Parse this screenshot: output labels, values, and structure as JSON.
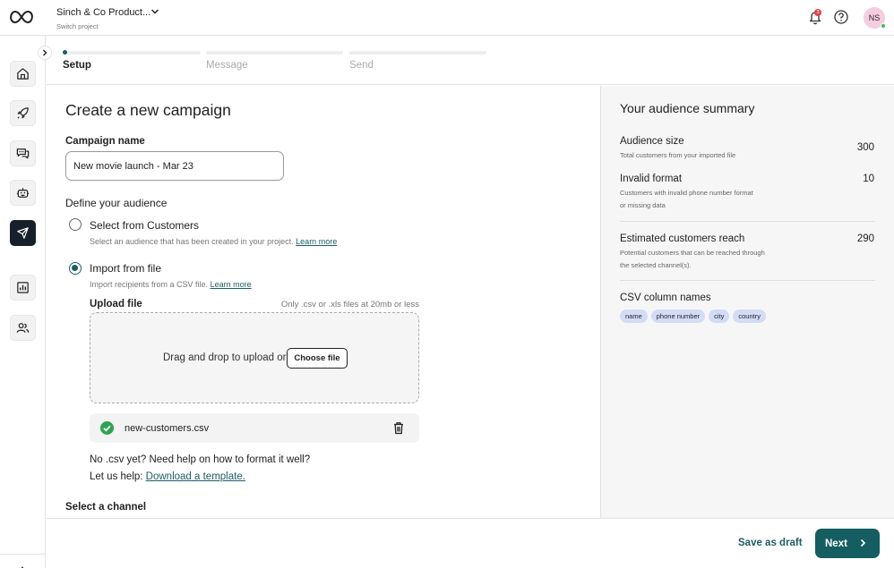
{
  "header": {
    "project_name": "Sinch & Co Product...",
    "project_sub": "Switch project",
    "notification_count": "3",
    "avatar_initials": "NS"
  },
  "icons": {
    "logo": "infinity-logo",
    "notifications": "bell-icon",
    "help": "help-circle-icon",
    "nav": [
      "home-icon",
      "rocket-icon",
      "chat-bubbles-icon",
      "bot-icon",
      "megaphone-icon",
      "chart-icon",
      "users-icon"
    ],
    "settings": "gear-icon"
  },
  "stepper": {
    "steps": [
      {
        "label": "Setup",
        "state": "current"
      },
      {
        "label": "Message",
        "state": "upcoming"
      },
      {
        "label": "Send",
        "state": "upcoming"
      }
    ]
  },
  "main": {
    "title": "Create a new campaign",
    "campaign_name_label": "Campaign name",
    "campaign_name_value": "New movie launch - Mar 23",
    "audience_label": "Define your audience",
    "options": [
      {
        "label": "Select from Customers",
        "desc": "Select an audience that has been created in your project.",
        "link": "Learn more",
        "checked": false
      },
      {
        "label": "Import from file",
        "desc": "Import recipients from a CSV file.",
        "link": "Learn more",
        "checked": true
      }
    ],
    "upload": {
      "label": "Upload file",
      "hint": "Only .csv or .xls files at 20mb or less",
      "drop_text": "Drag and drop to upload or",
      "choose_button": "Choose file"
    },
    "file": {
      "name": "new-customers.csv"
    },
    "help_line1": "No .csv yet? Need help on how to format it well?",
    "help_line2_prefix": "Let us help:",
    "help_link": "Download a template.",
    "channel_label": "Select a channel"
  },
  "summary": {
    "title": "Your audience summary",
    "metrics": [
      {
        "label": "Audience size",
        "desc": "Total customers from your imported file",
        "value": "300"
      },
      {
        "label": "Invalid format",
        "desc": "Customers with invalid phone number format or missing data",
        "value": "10"
      },
      {
        "label": "Estimated customers reach",
        "desc": "Potential customers that can be reached through the selected channel(s).",
        "value": "290"
      }
    ],
    "csv_title": "CSV column names",
    "columns": [
      "name",
      "phone number",
      "city",
      "country"
    ]
  },
  "footer": {
    "draft": "Save as draft",
    "next": "Next"
  },
  "colors": {
    "accent": "#145e62",
    "chip": "#d3dcf5",
    "badge": "#e04050",
    "avatar": "#f5cde1",
    "success": "#2fa352"
  }
}
